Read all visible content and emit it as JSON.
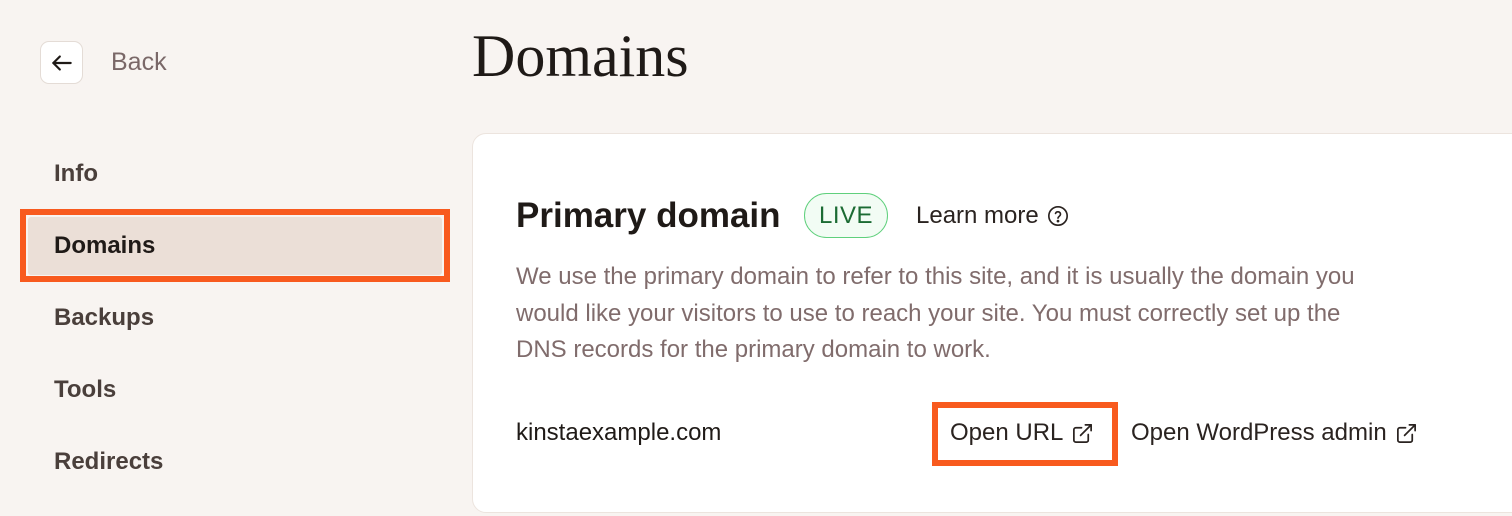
{
  "header": {
    "back_label": "Back",
    "title": "Domains"
  },
  "sidebar": {
    "items": [
      {
        "label": "Info",
        "active": false
      },
      {
        "label": "Domains",
        "active": true
      },
      {
        "label": "Backups",
        "active": false
      },
      {
        "label": "Tools",
        "active": false
      },
      {
        "label": "Redirects",
        "active": false
      }
    ]
  },
  "primary_domain": {
    "title": "Primary domain",
    "status_badge": "LIVE",
    "learn_more_label": "Learn more",
    "description": "We use the primary domain to refer to this site, and it is usually the domain you would like your visitors to use to reach your site. You must correctly set up the DNS records for the primary domain to work.",
    "domain": "kinstaexample.com",
    "open_url_label": "Open URL",
    "open_wp_admin_label": "Open WordPress admin"
  },
  "colors": {
    "highlight": "#f85a1e",
    "live_border": "#5fd07c",
    "active_item_bg": "#ebdfd7",
    "page_bg": "#f8f4f1"
  },
  "icons": {
    "back": "arrow-left-icon",
    "help": "question-circle-icon",
    "external": "external-link-icon"
  }
}
